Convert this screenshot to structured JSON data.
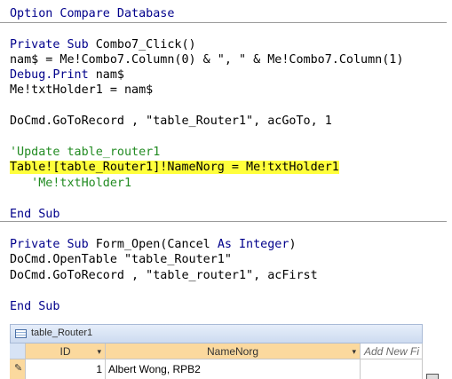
{
  "code": {
    "option_line": "Option Compare Database",
    "sub1": {
      "decl_private": "Private",
      "decl_sub": "Sub",
      "decl_name": " Combo7_Click()",
      "line1": "nam$ = Me!Combo7.Column(0) & \", \" & Me!Combo7.Column(1)",
      "line2_kw": "Debug.Print",
      "line2_rest": " nam$",
      "line3": "Me!txtHolder1 = nam$",
      "line4": "DoCmd.GoToRecord , \"table_Router1\", acGoTo, 1",
      "comment1": "'Update table_router1",
      "highlight_line": "Table![table_Router1]!NameNorg = Me!txtHolder1",
      "comment2": "   'Me!txtHolder1",
      "end": "End Sub"
    },
    "sub2": {
      "decl_private": "Private",
      "decl_sub": "Sub",
      "decl_name": " Form_Open(Cancel ",
      "decl_as": "As",
      "decl_integer": "Integer",
      "decl_close": ")",
      "line1": "DoCmd.OpenTable \"table_Router1\"",
      "line2": "DoCmd.GoToRecord , \"table_router1\", acFirst",
      "end": "End Sub"
    }
  },
  "table": {
    "title": "table_Router1",
    "columns": [
      "ID",
      "NameNorg",
      "Add New Fi"
    ],
    "row": {
      "id": "1",
      "name": "Albert Wong, RPB2"
    }
  }
}
